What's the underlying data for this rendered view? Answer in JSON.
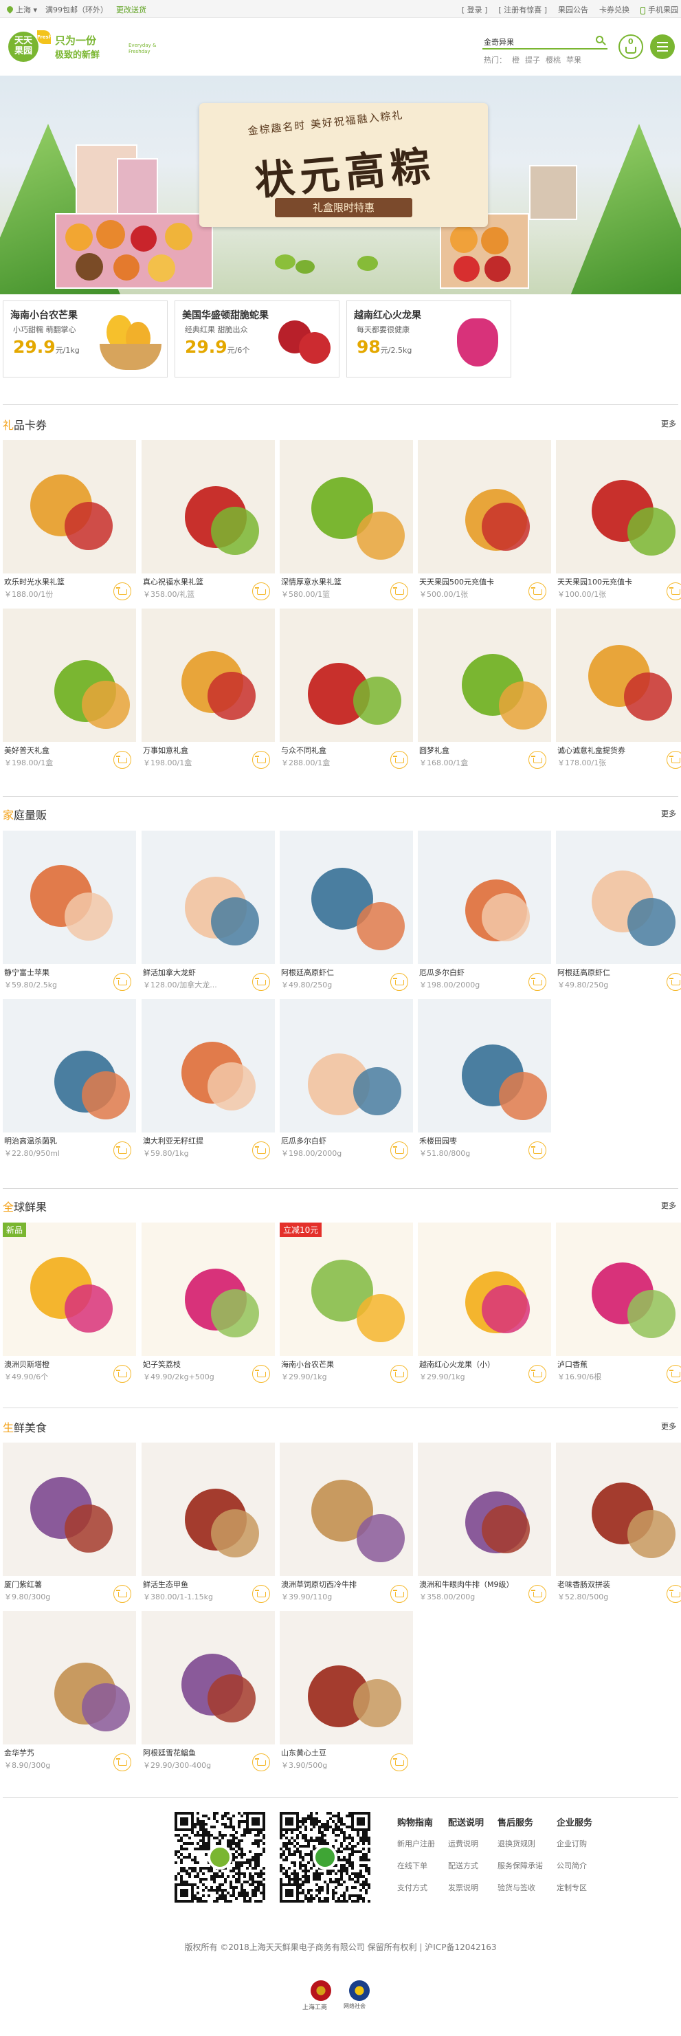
{
  "topbar": {
    "location": "上海",
    "shipping": "满99包邮（环外）",
    "switch": "更改送货",
    "login": "[ 登录 ]",
    "register": "[ 注册有惊喜 ]",
    "notice": "果园公告",
    "card": "卡券兑换",
    "mobile": "手机果园"
  },
  "header": {
    "logo_text": "天天果园",
    "logo_badge": "Fresh Day",
    "slogan_a": "只为一份",
    "slogan_b": "极致的新鲜",
    "slogan_c": "Everyday & Freshday",
    "search_value": "金奇异果",
    "hot_label": "热门：",
    "hot_items": [
      "橙",
      "提子",
      "樱桃",
      "苹果"
    ],
    "cart_count": "0"
  },
  "banner": {
    "line1": "金棕趣名时  美好祝福融入粽礼",
    "title": "状元高粽",
    "ribbon": "礼盒限时特惠"
  },
  "promos": [
    {
      "title": "海南小台农芒果",
      "sub": "小巧甜糯 萌翻掌心",
      "price": "29.9",
      "unit": "元/1kg"
    },
    {
      "title": "美国华盛顿甜脆蛇果",
      "sub": "经典红果 甜脆出众",
      "price": "29.9",
      "unit": "元/6个"
    },
    {
      "title": "越南红心火龙果",
      "sub": "每天都要很健康",
      "price": "98",
      "unit": "元/2.5kg"
    }
  ],
  "sections": [
    {
      "title_first": "礼",
      "title_rest": "品卡券",
      "more": "更多",
      "items": [
        {
          "name": "欢乐时光水果礼篮",
          "price": "￥188.00/1份"
        },
        {
          "name": "真心祝福水果礼篮",
          "price": "￥358.00/礼篮"
        },
        {
          "name": "深情厚意水果礼篮",
          "price": "￥580.00/1篮"
        },
        {
          "name": "天天果园500元充值卡",
          "price": "￥500.00/1张"
        },
        {
          "name": "天天果园100元充值卡",
          "price": "￥100.00/1张"
        },
        {
          "name": "美好普天礼盒",
          "price": "￥198.00/1盒"
        },
        {
          "name": "万事如意礼盒",
          "price": "￥198.00/1盒"
        },
        {
          "name": "与众不同礼盒",
          "price": "￥288.00/1盒"
        },
        {
          "name": "圆梦礼盒",
          "price": "￥168.00/1盒"
        },
        {
          "name": "诚心诚意礼盒提货券",
          "price": "￥178.00/1张"
        }
      ]
    },
    {
      "title_first": "家",
      "title_rest": "庭量贩",
      "more": "更多",
      "items": [
        {
          "name": "静宁富士苹果",
          "price": "￥59.80/2.5kg"
        },
        {
          "name": "鲜活加拿大龙虾",
          "price": "￥128.00/加拿大龙..."
        },
        {
          "name": "阿根廷高原虾仁",
          "price": "￥49.80/250g"
        },
        {
          "name": "厄瓜多尔白虾",
          "price": "￥198.00/2000g"
        },
        {
          "name": "阿根廷高原虾仁",
          "price": "￥49.80/250g"
        },
        {
          "name": "明治高温杀菌乳",
          "price": "￥22.80/950ml"
        },
        {
          "name": "澳大利亚无籽红提",
          "price": "￥59.80/1kg"
        },
        {
          "name": "厄瓜多尔白虾",
          "price": "￥198.00/2000g"
        },
        {
          "name": "禾楼田园枣",
          "price": "￥51.80/800g"
        }
      ]
    },
    {
      "title_first": "全",
      "title_rest": "球鲜果",
      "more": "更多",
      "items": [
        {
          "name": "澳洲贝斯塔橙",
          "price": "￥49.90/6个",
          "tag": "新品"
        },
        {
          "name": "妃子笑荔枝",
          "price": "￥49.90/2kg+500g"
        },
        {
          "name": "海南小台农芒果",
          "price": "￥29.90/1kg",
          "tag": "立减10元"
        },
        {
          "name": "越南红心火龙果（小）",
          "price": "￥29.90/1kg"
        },
        {
          "name": "泸口香蕉",
          "price": "￥16.90/6根"
        }
      ]
    },
    {
      "title_first": "生",
      "title_rest": "鲜美食",
      "more": "更多",
      "items": [
        {
          "name": "厦门紫红薯",
          "price": "￥9.80/300g"
        },
        {
          "name": "鲜活生态甲鱼",
          "price": "￥380.00/1-1.15kg"
        },
        {
          "name": "澳洲草饲原切西冷牛排",
          "price": "￥39.90/110g"
        },
        {
          "name": "澳洲和牛眼肉牛排（M9级）",
          "price": "￥358.00/200g"
        },
        {
          "name": "老味香肠双拼装",
          "price": "￥52.80/500g"
        },
        {
          "name": "金华芋艿",
          "price": "￥8.90/300g"
        },
        {
          "name": "阿根廷雪花鲳鱼",
          "price": "￥29.90/300-400g"
        },
        {
          "name": "山东黄心土豆",
          "price": "￥3.90/500g"
        }
      ]
    }
  ],
  "footer": {
    "cols": [
      {
        "head": "购物指南",
        "items": [
          "新用户注册",
          "在线下单",
          "支付方式"
        ]
      },
      {
        "head": "配送说明",
        "items": [
          "运费说明",
          "配送方式",
          "发票说明"
        ]
      },
      {
        "head": "售后服务",
        "items": [
          "退换货规则",
          "服务保障承诺",
          "验货与签收"
        ]
      },
      {
        "head": "企业服务",
        "items": [
          "企业订购",
          "公司简介",
          "定制专区"
        ]
      }
    ],
    "copyright": "版权所有 ©2018上海天天鲜果电子商务有限公司 保留所有权利 | 沪ICP备12042163",
    "badge1": "上海工商",
    "badge2": "网络社会"
  },
  "colors": {
    "brand_green": "#7ab631",
    "accent_orange": "#f3a21a",
    "price_yellow": "#e4a800"
  }
}
